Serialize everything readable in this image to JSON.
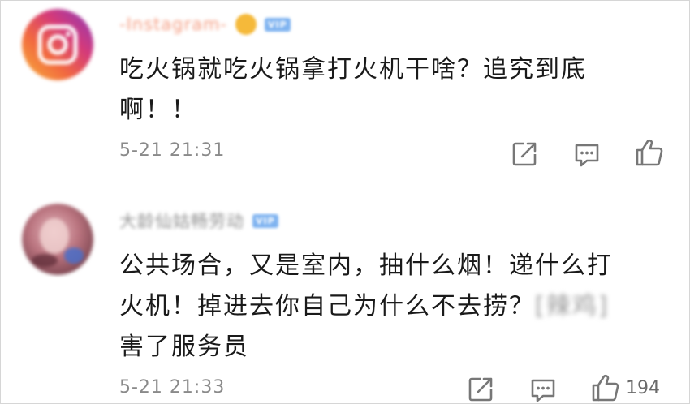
{
  "comments": [
    {
      "username": "-Instagram-",
      "badge": "VIP",
      "text_lines": [
        "吃火锅就吃火锅拿打火机干啥？追究到底",
        "啊！！"
      ],
      "blur_tail": "",
      "time": "5-21 21:31",
      "like_count": "",
      "avatar_icon": "instagram-logo-icon"
    },
    {
      "username": "大龄仙姑畅劳动",
      "badge": "VIP",
      "text_lines": [
        "公共场合，又是室内，抽什么烟！递什么打",
        "火机！掉进去你自己为什么不去捞？",
        "害了服务员"
      ],
      "blur_tail": "[辣鸡]",
      "time": "5-21 21:33",
      "like_count": "194",
      "avatar_icon": "user-avatar-icon"
    }
  ],
  "colors": {
    "text": "#1a1a1a",
    "meta": "#8a8a8a",
    "instagram_orange": "#f28a6a",
    "vip_blue": "#7fb3f0"
  }
}
